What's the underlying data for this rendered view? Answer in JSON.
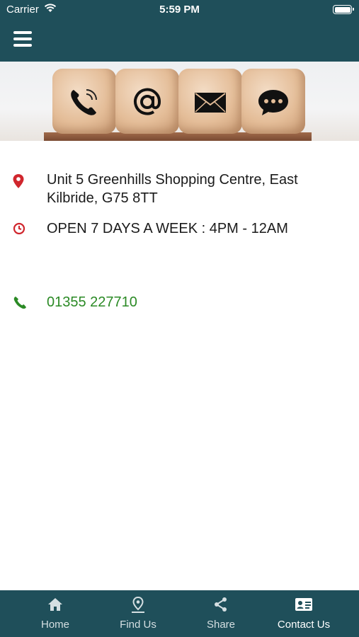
{
  "status_bar": {
    "carrier": "Carrier",
    "time": "5:59 PM"
  },
  "header": {
    "menu_icon": "hamburger-menu-icon"
  },
  "banner": {
    "icons": [
      "phone-icon",
      "at-sign-icon",
      "envelope-icon",
      "chat-bubble-icon"
    ]
  },
  "contact": {
    "address": "Unit 5 Greenhills Shopping Centre, East Kilbride, G75 8TT",
    "hours": "OPEN 7 DAYS A WEEK : 4PM - 12AM",
    "phone": "01355 227710"
  },
  "colors": {
    "bar": "#1f4f5a",
    "pin": "#d0262d",
    "phone": "#2b8a25"
  },
  "tabs": [
    {
      "label": "Home",
      "icon": "home-icon"
    },
    {
      "label": "Find Us",
      "icon": "location-pin-icon"
    },
    {
      "label": "Share",
      "icon": "share-icon"
    },
    {
      "label": "Contact Us",
      "icon": "contact-card-icon",
      "active": true
    }
  ]
}
